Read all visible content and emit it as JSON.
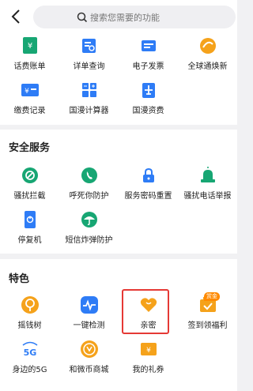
{
  "search": {
    "placeholder": "搜索您需要的功能"
  },
  "top_grid": [
    {
      "label": "话费账单",
      "icon": "bill-icon"
    },
    {
      "label": "详单查询",
      "icon": "detail-query-icon"
    },
    {
      "label": "电子发票",
      "icon": "invoice-icon"
    },
    {
      "label": "全球通焕新",
      "icon": "global-renew-icon"
    },
    {
      "label": "缴费记录",
      "icon": "payment-record-icon"
    },
    {
      "label": "国漫计算器",
      "icon": "calculator-icon"
    },
    {
      "label": "国漫资费",
      "icon": "airplane-icon"
    }
  ],
  "security": {
    "title": "安全服务",
    "items": [
      {
        "label": "骚扰拦截",
        "icon": "block-icon"
      },
      {
        "label": "呼死你防护",
        "icon": "phone-shield-icon"
      },
      {
        "label": "服务密码重置",
        "icon": "lock-icon"
      },
      {
        "label": "骚扰电话举报",
        "icon": "alarm-icon"
      },
      {
        "label": "停复机",
        "icon": "power-phone-icon"
      },
      {
        "label": "短信炸弹防护",
        "icon": "umbrella-icon"
      }
    ]
  },
  "features": {
    "title": "特色",
    "badge": "赏金",
    "items": [
      {
        "label": "摇钱树",
        "icon": "money-tree-icon"
      },
      {
        "label": "一键检测",
        "icon": "pulse-check-icon"
      },
      {
        "label": "亲密",
        "icon": "heart-icon"
      },
      {
        "label": "签到领福利",
        "icon": "checkin-icon"
      },
      {
        "label": "身边的5G",
        "icon": "5g-icon"
      },
      {
        "label": "和微币商城",
        "icon": "coin-icon"
      },
      {
        "label": "我的礼券",
        "icon": "coupon-icon"
      }
    ]
  },
  "colors": {
    "green": "#17a673",
    "blue": "#2e7cf6",
    "orange": "#f5a21b",
    "highlight": "#e53935"
  }
}
